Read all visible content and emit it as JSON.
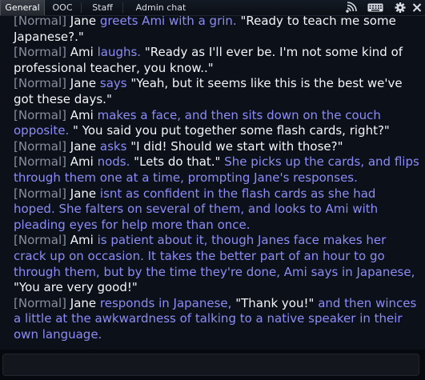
{
  "tabs": [
    {
      "label": "General",
      "active": true
    },
    {
      "label": "OOC",
      "active": false
    },
    {
      "label": "Staff",
      "active": false
    },
    {
      "label": "Admin chat",
      "active": false
    }
  ],
  "icons": [
    "signal-icon",
    "keyboard-icon",
    "gear-icon",
    "close-icon"
  ],
  "colors": {
    "background": "#0b1019",
    "channel_tag": "#8a8fa0",
    "action_text": "#8d8cf6",
    "speech_text": "#f4f5f8",
    "active_tab": "#2e333b"
  },
  "chat": {
    "channel": "[Normal]",
    "messages": [
      {
        "speaker": "Jane",
        "action": "greets Ami with a grin.",
        "speech": "\"Ready to teach me some Japanese?.\"",
        "action2": ""
      },
      {
        "speaker": "Ami",
        "action": "laughs.",
        "speech": "\"Ready as I'll ever be. I'm not some kind of professional teacher, you know..\"",
        "action2": ""
      },
      {
        "speaker": "Jane",
        "action": "says",
        "speech": "\"Yeah, but it seems like this is the best we've got these days.\"",
        "action2": ""
      },
      {
        "speaker": "Ami",
        "action": "makes a face, and then sits down on the couch opposite.",
        "speech": "\" You said you put together some flash cards, right?\"",
        "action2": ""
      },
      {
        "speaker": "Jane",
        "action": "asks",
        "speech": "\"I did! Should we start with those?\"",
        "action2": ""
      },
      {
        "speaker": "Ami",
        "action": "nods.",
        "speech": "\"Lets do that.\"",
        "action2": "She picks up the cards, and flips through them one at a time, prompting Jane's responses."
      },
      {
        "speaker": "Jane",
        "action": "isnt as confident in the flash cards as she had hoped. She falters on several of them, and looks to Ami with pleading eyes for help more than once.",
        "speech": "",
        "action2": ""
      },
      {
        "speaker": "Ami",
        "action": "is patient about it, though Janes face makes her crack up on occasion. It takes the better part of an hour to go through them, but by the time they're done, Ami says in Japanese,",
        "speech": "\"You are very good!\"",
        "action2": ""
      },
      {
        "speaker": "Jane",
        "action": "responds in Japanese,",
        "speech": "\"Thank you!\"",
        "action2": "and then winces a little at the awkwardness of talking to a native speaker in their own language."
      }
    ]
  },
  "input": {
    "value": "",
    "placeholder": ""
  }
}
